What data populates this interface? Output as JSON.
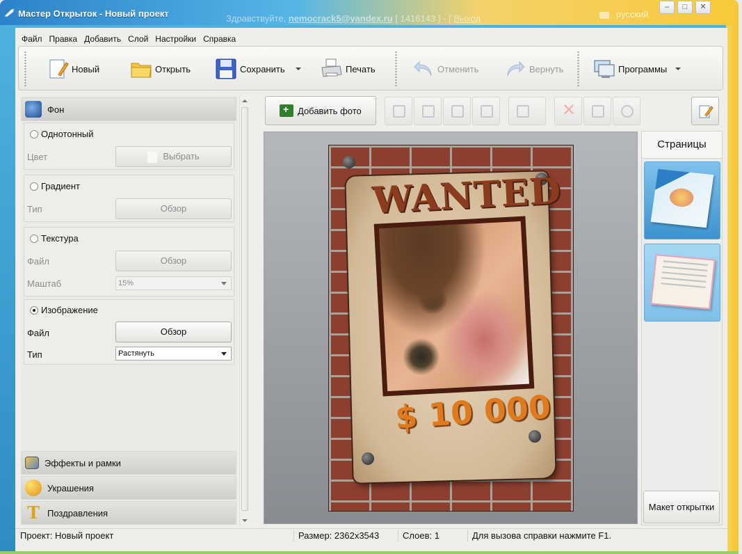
{
  "window": {
    "title": "Мастер Открыток - Новый проект",
    "user_prefix": "Здравствуйте, ",
    "user_email": "nemocrack5@yandex.ru",
    "user_id": "[ 1416143 ] - [",
    "exit": "Выход",
    "language": "русский"
  },
  "menu": [
    "Файл",
    "Правка",
    "Добавить",
    "Слой",
    "Настройки",
    "Справка"
  ],
  "toolbar": {
    "new": "Новый",
    "open": "Открыть",
    "save": "Сохранить",
    "print": "Печать",
    "undo": "Отменить",
    "redo": "Вернуть",
    "programs": "Программы"
  },
  "background": {
    "header": "Фон",
    "solid": {
      "label": "Однотонный",
      "color_label": "Цвет",
      "choose": "Выбрать"
    },
    "gradient": {
      "label": "Градиент",
      "type_label": "Тип",
      "browse": "Обзор"
    },
    "texture": {
      "label": "Текстура",
      "file_label": "Файл",
      "browse": "Обзор",
      "scale_label": "Маштаб",
      "scale_value": "15%"
    },
    "image": {
      "label": "Изображение",
      "file_label": "Файл",
      "browse": "Обзор",
      "type_label": "Тип",
      "type_value": "Растянуть",
      "selected": true
    }
  },
  "sections": {
    "effects": "Эффекты и рамки",
    "decorations": "Украшения",
    "greetings": "Поздравления"
  },
  "center": {
    "add_photo": "Добавить фото"
  },
  "poster": {
    "headline": "WANTED",
    "price": "$ 10 000"
  },
  "pages": {
    "tab": "Страницы",
    "layout_button": "Макет открытки"
  },
  "status": {
    "project": "Проект: Новый проект",
    "size": "Размер: 2362x3543",
    "layers": "Слоев: 1",
    "help": "Для вызова справки нажмите F1."
  },
  "colors": {
    "title_blue": "#2d82c8",
    "title_yellow": "#f7c93a",
    "price_orange": "#e07a1e",
    "wanted_brown": "#8b3b1e"
  }
}
